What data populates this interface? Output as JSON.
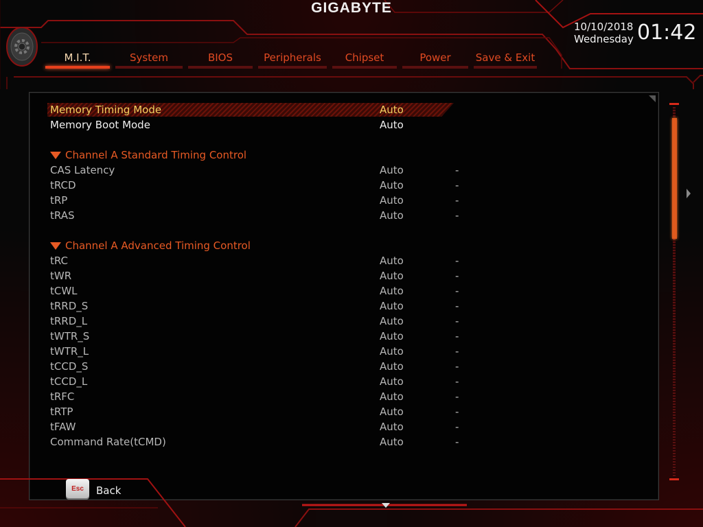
{
  "brand": "GIGABYTE",
  "datetime": {
    "date": "10/10/2018",
    "weekday": "Wednesday",
    "time": "01:42"
  },
  "tabs": [
    {
      "label": "M.I.T.",
      "active": true
    },
    {
      "label": "System",
      "active": false
    },
    {
      "label": "BIOS",
      "active": false
    },
    {
      "label": "Peripherals",
      "active": false
    },
    {
      "label": "Chipset",
      "active": false
    },
    {
      "label": "Power",
      "active": false
    },
    {
      "label": "Save & Exit",
      "active": false
    }
  ],
  "settings": {
    "memory_timing_mode": {
      "label": "Memory Timing Mode",
      "value": "Auto"
    },
    "memory_boot_mode": {
      "label": "Memory Boot Mode",
      "value": "Auto"
    },
    "standard_section": "Channel A Standard Timing Control",
    "standard": [
      {
        "label": "CAS Latency",
        "value": "Auto",
        "current": "-"
      },
      {
        "label": "tRCD",
        "value": "Auto",
        "current": "-"
      },
      {
        "label": "tRP",
        "value": "Auto",
        "current": "-"
      },
      {
        "label": "tRAS",
        "value": "Auto",
        "current": "-"
      }
    ],
    "advanced_section": "Channel A Advanced Timing Control",
    "advanced": [
      {
        "label": "tRC",
        "value": "Auto",
        "current": "-"
      },
      {
        "label": "tWR",
        "value": "Auto",
        "current": "-"
      },
      {
        "label": "tCWL",
        "value": "Auto",
        "current": "-"
      },
      {
        "label": "tRRD_S",
        "value": "Auto",
        "current": "-"
      },
      {
        "label": "tRRD_L",
        "value": "Auto",
        "current": "-"
      },
      {
        "label": "tWTR_S",
        "value": "Auto",
        "current": "-"
      },
      {
        "label": "tWTR_L",
        "value": "Auto",
        "current": "-"
      },
      {
        "label": "tCCD_S",
        "value": "Auto",
        "current": "-"
      },
      {
        "label": "tCCD_L",
        "value": "Auto",
        "current": "-"
      },
      {
        "label": "tRFC",
        "value": "Auto",
        "current": "-"
      },
      {
        "label": "tRTP",
        "value": "Auto",
        "current": "-"
      },
      {
        "label": "tFAW",
        "value": "Auto",
        "current": "-"
      },
      {
        "label": "Command Rate(tCMD)",
        "value": "Auto",
        "current": "-"
      }
    ]
  },
  "footer": {
    "esc_key": "Esc",
    "back_label": "Back"
  },
  "colors": {
    "accent": "#e7401d",
    "selected_text": "#f4d060",
    "section_text": "#e85a24"
  }
}
